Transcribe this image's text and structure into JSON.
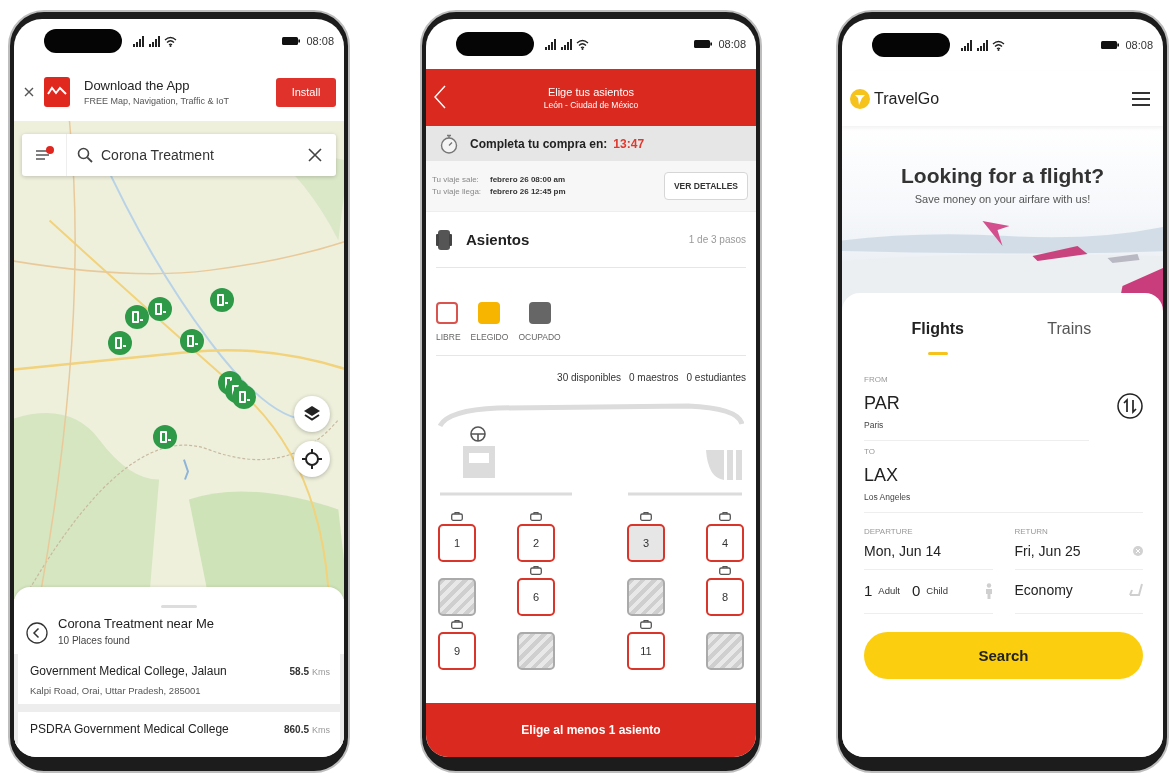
{
  "map_app": {
    "status_bar": {
      "time": "08:08"
    },
    "banner": {
      "title": "Download the App",
      "subtitle": "FREE Map, Navigation, Traffic & IoT",
      "button": "Install"
    },
    "search": {
      "value": "Corona Treatment",
      "filter_active": true
    },
    "results": {
      "title": "Corona Treatment near Me",
      "count": "10 Places found",
      "places": [
        {
          "name": "Government Medical College, Jalaun",
          "distance": "58.5",
          "unit": "Kms",
          "address": "Kalpi Road, Orai, Uttar Pradesh, 285001"
        },
        {
          "name": "PSDRA Government Medical College",
          "distance": "860.5",
          "unit": "Kms"
        }
      ]
    }
  },
  "seat_app": {
    "status_bar": {
      "time": "08:08"
    },
    "header": {
      "title": "Elige tus asientos",
      "subtitle": "León - Ciudad de México"
    },
    "timer": {
      "label": "Completa tu compra en:",
      "time": "13:47"
    },
    "trip": [
      {
        "label": "Tu viaje sale:",
        "value": "febrero 26 08:00 am"
      },
      {
        "label": "Tu viaje llega:",
        "value": "febrero 26 12:45 pm"
      }
    ],
    "details_button": "VER DETALLES",
    "section": {
      "title": "Asientos",
      "step": "1 de 3 pasos"
    },
    "legend": [
      {
        "kind": "free",
        "label": "LIBRE"
      },
      {
        "kind": "chosen",
        "label": "ELEGIDO"
      },
      {
        "kind": "occupied",
        "label": "OCUPADO"
      }
    ],
    "counts": [
      "30 disponibles",
      "0 maestros",
      "0 estudiantes"
    ],
    "seat_rows": [
      [
        {
          "kind": "free",
          "number": "1",
          "focused": false
        },
        {
          "kind": "free",
          "number": "2",
          "focused": false
        },
        {
          "kind": "free",
          "number": "3",
          "focused": true
        },
        {
          "kind": "free",
          "number": "4",
          "focused": false
        }
      ],
      [
        {
          "kind": "occupied"
        },
        {
          "kind": "free",
          "number": "6",
          "focused": false
        },
        {
          "kind": "occupied"
        },
        {
          "kind": "free",
          "number": "8",
          "focused": false
        }
      ],
      [
        {
          "kind": "free",
          "number": "9",
          "focused": false
        },
        {
          "kind": "occupied"
        },
        {
          "kind": "free",
          "number": "11",
          "focused": false
        },
        {
          "kind": "occupied"
        }
      ]
    ],
    "footer": "Elige al menos 1 asiento"
  },
  "flight_app": {
    "status_bar": {
      "time": "08:08"
    },
    "brand": "TravelGo",
    "hero": {
      "title": "Looking for a flight?",
      "subtitle": "Save money on your airfare with us!"
    },
    "tabs": [
      {
        "label": "Flights",
        "selected": true
      },
      {
        "label": "Trains",
        "selected": false
      }
    ],
    "from": {
      "label": "FROM",
      "code": "PAR",
      "city": "Paris"
    },
    "to": {
      "label": "TO",
      "code": "LAX",
      "city": "Los Angeles"
    },
    "departure": {
      "label": "DEPARTURE",
      "value": "Mon, Jun 14"
    },
    "return": {
      "label": "RETURN",
      "value": "Fri, Jun 25"
    },
    "passengers": [
      {
        "count": "1",
        "label": "Adult"
      },
      {
        "count": "0",
        "label": "Child"
      }
    ],
    "cabin": "Economy",
    "search_button": "Search"
  }
}
